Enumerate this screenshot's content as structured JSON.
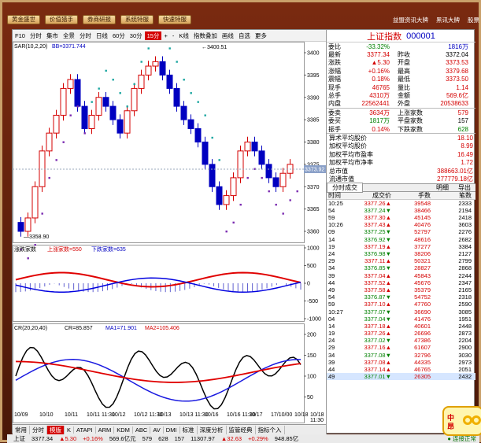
{
  "topbar": {
    "buttons": [
      "黄金盛世",
      "价值猎手",
      "券商研报",
      "系统特服",
      "快速特服"
    ],
    "right": [
      "益盟资讯大牌",
      "黑讯大牌",
      "股票"
    ]
  },
  "toolbar": [
    "F10",
    "分时",
    "集市",
    "全景",
    "分时",
    "日线",
    "60分",
    "30分",
    "15分",
    "+",
    "-",
    "K线",
    "指数叠加",
    "画线",
    "自选",
    "更多"
  ],
  "main_chart": {
    "title": "SAR",
    "params": "(10,2,20)",
    "bb": "BB=3371.744",
    "yticks": [
      "3400",
      "3395",
      "3390",
      "3385",
      "3380",
      "3375",
      "3370",
      "3365",
      "3360"
    ],
    "hi_label": "3400.51",
    "lo_label": "3358.90",
    "price_tag": "3373.92"
  },
  "rise_fall": {
    "title": "涨跌家数",
    "up_label": "上涨家数=550",
    "down_label": "下跌家数=635",
    "yticks": [
      "1000",
      "500",
      "0",
      "-500",
      "-1000"
    ]
  },
  "cr": {
    "title": "CR",
    "params": "(20,20,40)",
    "cr": "CR=85.857",
    "ma1": "MA1=71.901",
    "ma2": "MA2=105.406",
    "yticks": [
      "200",
      "150",
      "100",
      "50"
    ]
  },
  "dates": [
    "10/09",
    "10/10",
    "10/11",
    "10/11 11:30",
    "10/12",
    "10/12 11:30",
    "10/13",
    "10/13 11:30",
    "10/16",
    "10/16 11:30",
    "10/17",
    "17/10/00",
    "10/18",
    "10/18 11:30"
  ],
  "bottomtabs": [
    "常用",
    "分时",
    "模版",
    "K",
    "ATAPI",
    "ARM",
    "KDM",
    "ABC",
    "AV",
    "DMI",
    "标准",
    "深度分析",
    "",
    "监管经典",
    "指标个入"
  ],
  "quote": {
    "name": "上证指数",
    "code": "000001",
    "rows": [
      [
        "委比",
        "-33.32%",
        "",
        "1816万"
      ],
      [
        "最新",
        "3377.34",
        "昨收",
        "3372.04"
      ],
      [
        "涨跌",
        "▲5.30",
        "开盘",
        "3373.53"
      ],
      [
        "涨幅",
        "+0.16%",
        "最高",
        "3379.68"
      ],
      [
        "震幅",
        "0.18%",
        "最低",
        "3373.50"
      ],
      [
        "现手",
        "46765",
        "量比",
        "1.14"
      ],
      [
        "总手",
        "4310万",
        "金额",
        "569.6亿"
      ],
      [
        "内盘",
        "22562441",
        "外盘",
        "20538633"
      ]
    ],
    "rows2": [
      [
        "委卖",
        "3634万",
        "上涨家数",
        "579"
      ],
      [
        "委买",
        "1817万",
        "平盘家数",
        "157"
      ],
      [
        "振手",
        "0.14%",
        "下跌家数",
        "628"
      ]
    ],
    "stats": [
      [
        "算术平均股价",
        "18.10"
      ],
      [
        "加权平均股价",
        "8.99"
      ],
      [
        "加权平均市盈率",
        "16.49"
      ],
      [
        "加权平均市净率",
        "1.72"
      ],
      [
        "总市值",
        "388663.01亿"
      ],
      [
        "流通市值",
        "277779.18亿"
      ]
    ],
    "tabs": [
      "分时成交",
      "明细",
      "导出"
    ],
    "ticks_header": [
      "时间",
      "成交价",
      "手数",
      "笔数"
    ],
    "ticks": [
      [
        "10:25",
        "3377.26▲",
        "39548",
        "2333"
      ],
      [
        "54",
        "3377.24▼",
        "38466",
        "2194"
      ],
      [
        "59",
        "3377.30▲",
        "45145",
        "2418"
      ],
      [
        "10:26",
        "3377.43▲",
        "40476",
        "3603"
      ],
      [
        "09",
        "3377.25▼",
        "52797",
        "2276"
      ],
      [
        "14",
        "3376.92▼",
        "48616",
        "2682"
      ],
      [
        "19",
        "3377.19▲",
        "37277",
        "3384"
      ],
      [
        "24",
        "3376.98▼",
        "38206",
        "2127"
      ],
      [
        "29",
        "3377.11▲",
        "50321",
        "2799"
      ],
      [
        "34",
        "3376.85▼",
        "28827",
        "2868"
      ],
      [
        "39",
        "3377.04▲",
        "45843",
        "2244"
      ],
      [
        "44",
        "3377.52▲",
        "45676",
        "2347"
      ],
      [
        "49",
        "3377.58▲",
        "35379",
        "2165"
      ],
      [
        "54",
        "3376.87▼",
        "54752",
        "2318"
      ],
      [
        "59",
        "3377.10▲",
        "47760",
        "2590"
      ],
      [
        "10:27",
        "3377.07▼",
        "36690",
        "3085"
      ],
      [
        "04",
        "3377.04▼",
        "41476",
        "1951"
      ],
      [
        "14",
        "3377.18▲",
        "40601",
        "2448"
      ],
      [
        "19",
        "3377.26▲",
        "26696",
        "2873"
      ],
      [
        "24",
        "3377.02▼",
        "47386",
        "2204"
      ],
      [
        "29",
        "3377.16▲",
        "61607",
        "2900"
      ],
      [
        "34",
        "3377.08▼",
        "32796",
        "3030"
      ],
      [
        "39",
        "3377.08▲",
        "44335",
        "2973"
      ],
      [
        "44",
        "3377.14▲",
        "46765",
        "2051"
      ],
      [
        "49",
        "3377.01▼",
        "26305",
        "2432"
      ]
    ]
  },
  "status": {
    "items": [
      "上证",
      "3377.34",
      "▲5.30",
      "+0.16%",
      "569.6亿元",
      "579",
      "628",
      "157",
      "11307.97",
      "▲32.63",
      "+0.29%",
      "948.85亿"
    ],
    "conn": "● 连接正常"
  },
  "widget": {
    "text": "中\n昂"
  },
  "colors": {
    "up": "#d40000",
    "down": "#0000c0",
    "accent": "#d40000"
  }
}
